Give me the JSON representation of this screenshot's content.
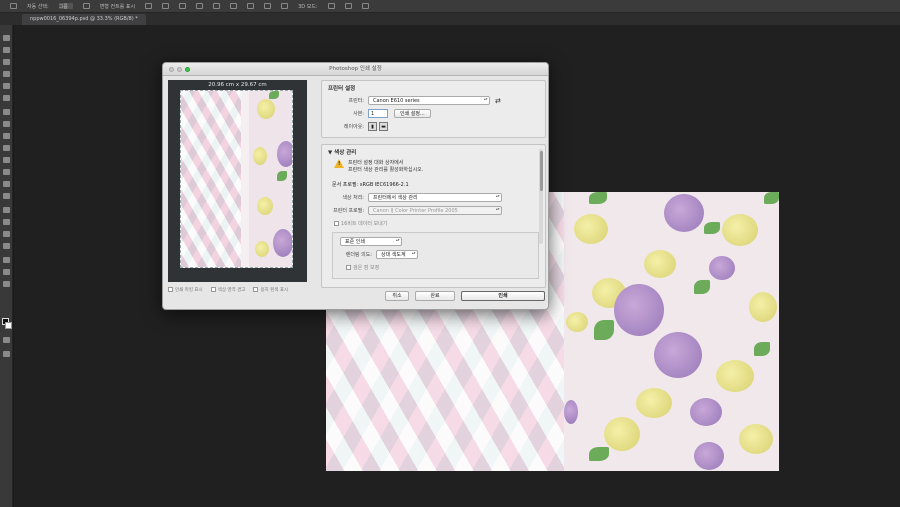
{
  "options_bar": {
    "auto_select_label": "자동 선택:",
    "auto_select_value": "그룹",
    "transform_controls_label": "변형 컨트롤 표시",
    "mode_label": "3D 모드:"
  },
  "document_tab": {
    "label": "nppw0016_06394p.psd @ 33.3% (RGB/8) *"
  },
  "dialog": {
    "title": "Photoshop 인쇄 설정",
    "preview": {
      "size_label": "20.96 cm x 29.67 cm",
      "checkbox_1": "인쇄 마킹 표시",
      "checkbox_2": "색상 영역 경고",
      "checkbox_3": "용지 흰색 표시"
    },
    "printer_setup": {
      "heading": "프린터 설정",
      "printer_label": "프린터:",
      "printer_value": "Canon E610 series",
      "copies_label": "사본:",
      "copies_value": "1",
      "print_settings_button": "인쇄 설정...",
      "layout_label": "레이아웃:"
    },
    "color_management": {
      "heading": "색상 관리",
      "warning_line1": "프린터 설정 대화 상자에서",
      "warning_line2": "프린터 색상 관리를 활성화하십시오.",
      "document_profile": "문서 프로필: sRGB IEC61966-2.1",
      "color_handling_label": "색상 처리:",
      "color_handling_value": "프린터에서 색상 관리",
      "printer_profile_label": "프린터 프로필:",
      "printer_profile_value": "Canon IJ Color Printer Profile 2005",
      "send_16bit_label": "16비트 데이터 보내기",
      "normal_printing_value": "표준 인쇄",
      "rendering_intent_label": "렌더링 의도:",
      "rendering_intent_value": "상대 색도계",
      "black_point_label": "검은 점 보정"
    },
    "buttons": {
      "cancel": "취소",
      "done": "완료",
      "print": "인쇄"
    }
  },
  "colors": {
    "app_bg": "#1a1a1b",
    "dialog_bg": "#e6e6e6",
    "warning": "#f0b429",
    "traffic_green": "#3ec84a"
  }
}
